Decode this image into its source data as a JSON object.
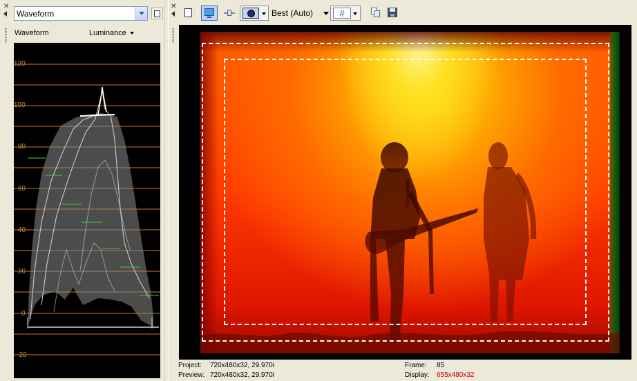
{
  "scopes": {
    "selected_scope": "Waveform",
    "scope_name": "Waveform",
    "mode": "Luminance",
    "y_axis_ticks": [
      "120",
      "100",
      "80",
      "60",
      "40",
      "20",
      "0",
      "-20"
    ]
  },
  "preview": {
    "quality": "Best (Auto)",
    "video_description_colors": {
      "accent": "#ff4a00",
      "highlight": "#fff200",
      "edge": "#0a5a10"
    }
  },
  "status": {
    "project_label": "Project:",
    "project_value": "720x480x32, 29.970i",
    "preview_label": "Preview:",
    "preview_value": "720x480x32, 29.970i",
    "frame_label": "Frame:",
    "frame_value": "85",
    "display_label": "Display:",
    "display_value": "655x480x32"
  },
  "icons": {
    "close": "close-icon",
    "collapse": "chevron-left-icon",
    "properties": "properties-icon",
    "monitor": "external-monitor-icon",
    "split": "split-screen-icon",
    "quality": "preview-quality-icon",
    "grid": "overlay-grid-icon",
    "copy": "copy-snapshot-icon",
    "save": "save-snapshot-icon"
  }
}
